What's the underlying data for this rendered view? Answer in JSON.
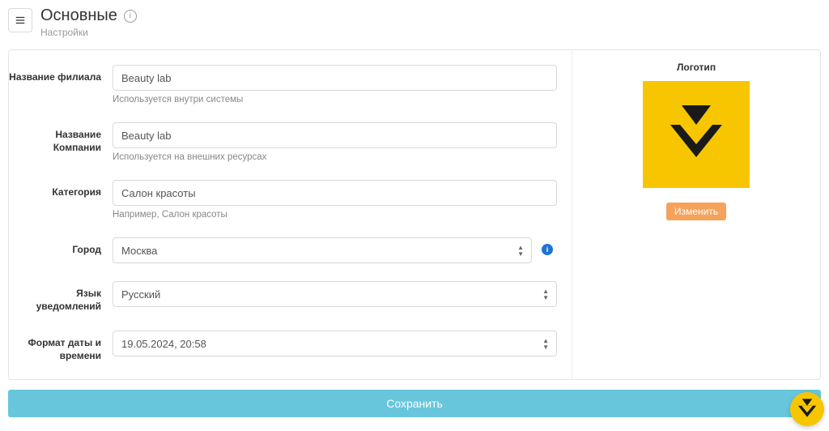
{
  "header": {
    "title": "Основные",
    "subtitle": "Настройки"
  },
  "form": {
    "branch_name": {
      "label": "Название филиала",
      "value": "Beauty lab",
      "hint": "Используется внутри системы"
    },
    "company_name": {
      "label": "Название Компании",
      "value": "Beauty lab",
      "hint": "Используется на внешних ресурсах"
    },
    "category": {
      "label": "Категория",
      "value": "Салон красоты",
      "hint": "Например, Салон красоты"
    },
    "city": {
      "label": "Город",
      "value": "Москва"
    },
    "language": {
      "label": "Язык уведомлений",
      "value": "Русский"
    },
    "date_format": {
      "label": "Формат даты и времени",
      "value": "19.05.2024, 20:58"
    }
  },
  "logo": {
    "title": "Логотип",
    "change_label": "Изменить"
  },
  "actions": {
    "save_label": "Сохранить"
  }
}
